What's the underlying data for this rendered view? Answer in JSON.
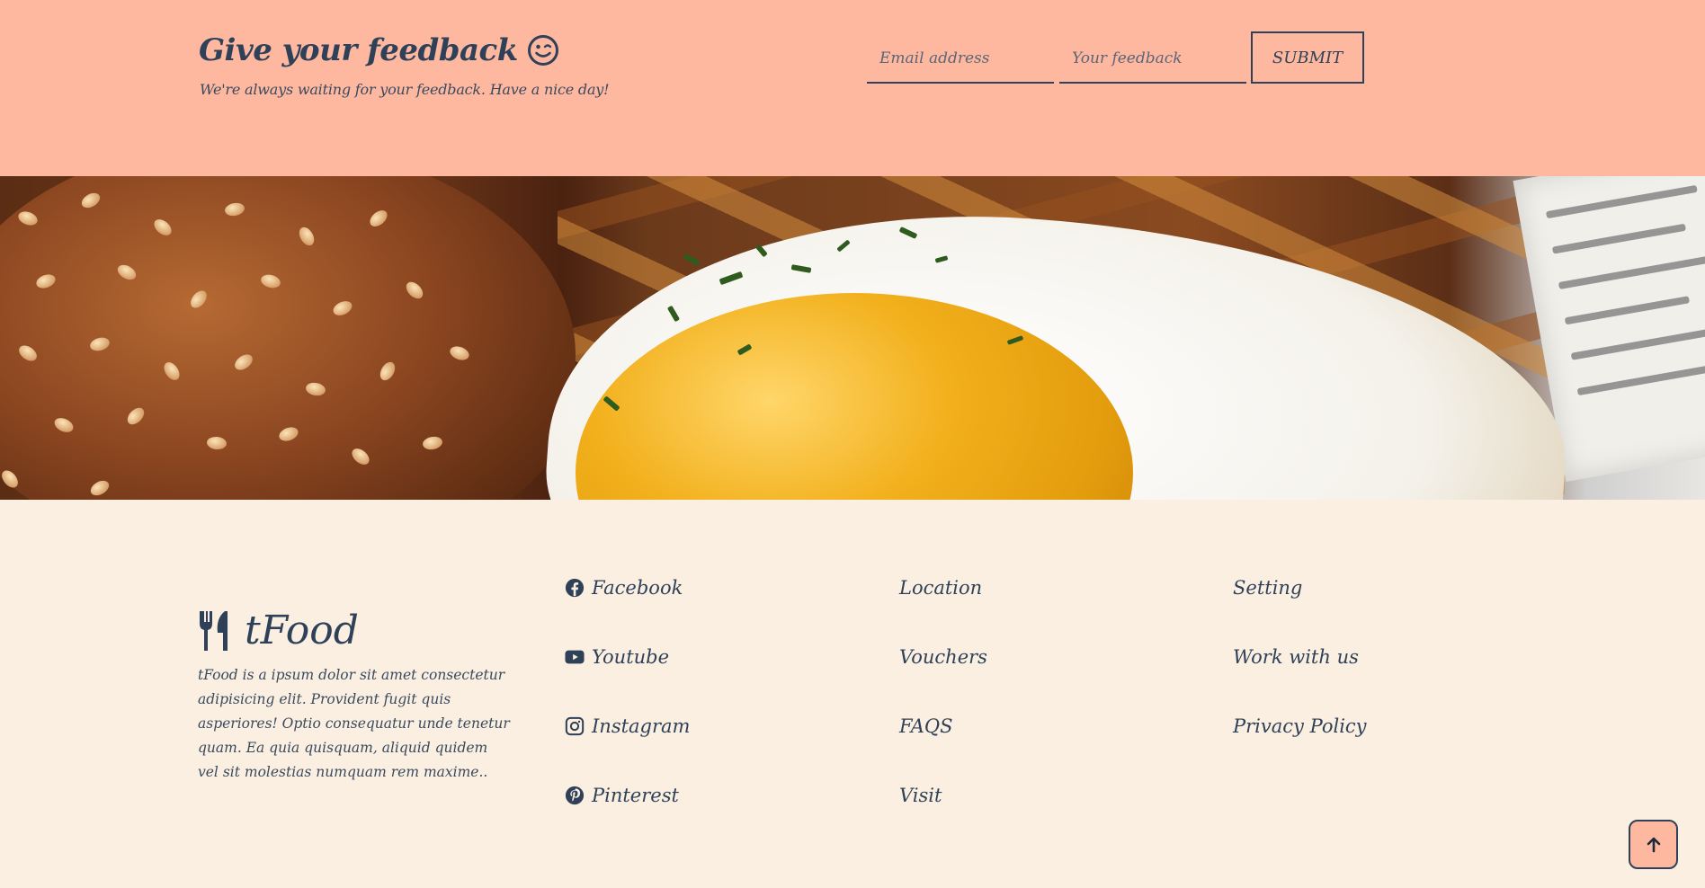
{
  "feedback": {
    "title": "Give your feedback",
    "title_icon": "wink-face-icon",
    "subtitle": "We're always waiting for your feedback. Have a nice day!",
    "email_placeholder": "Email address",
    "email_value": "",
    "feedback_placeholder": "Your feedback",
    "feedback_value": "",
    "submit_label": "SUBMIT"
  },
  "hero_image": {
    "icon": "food-photo-egg-burger-fries"
  },
  "footer": {
    "brand": "tFood",
    "brand_icon": "utensils-icon",
    "about": "tFood is a ipsum dolor sit amet consectetur adipisicing elit. Provident fugit quis asperiores! Optio consequatur unde tenetur quam. Ea quia quisquam, aliquid quidem vel sit molestias numquam rem maxime..",
    "social": [
      {
        "label": "Facebook",
        "icon": "facebook-icon"
      },
      {
        "label": "Youtube",
        "icon": "youtube-icon"
      },
      {
        "label": "Instagram",
        "icon": "instagram-icon"
      },
      {
        "label": "Pinterest",
        "icon": "pinterest-icon"
      }
    ],
    "info_links": [
      "Location",
      "Vouchers",
      "FAQS",
      "Visit"
    ],
    "more_links": [
      "Setting",
      "Work with us",
      "Privacy Policy"
    ]
  },
  "back_to_top": {
    "icon": "arrow-up-icon"
  },
  "colors": {
    "feedback_bg": "#ffb8a0",
    "footer_bg": "#fbefe1",
    "text": "#2f4158"
  }
}
